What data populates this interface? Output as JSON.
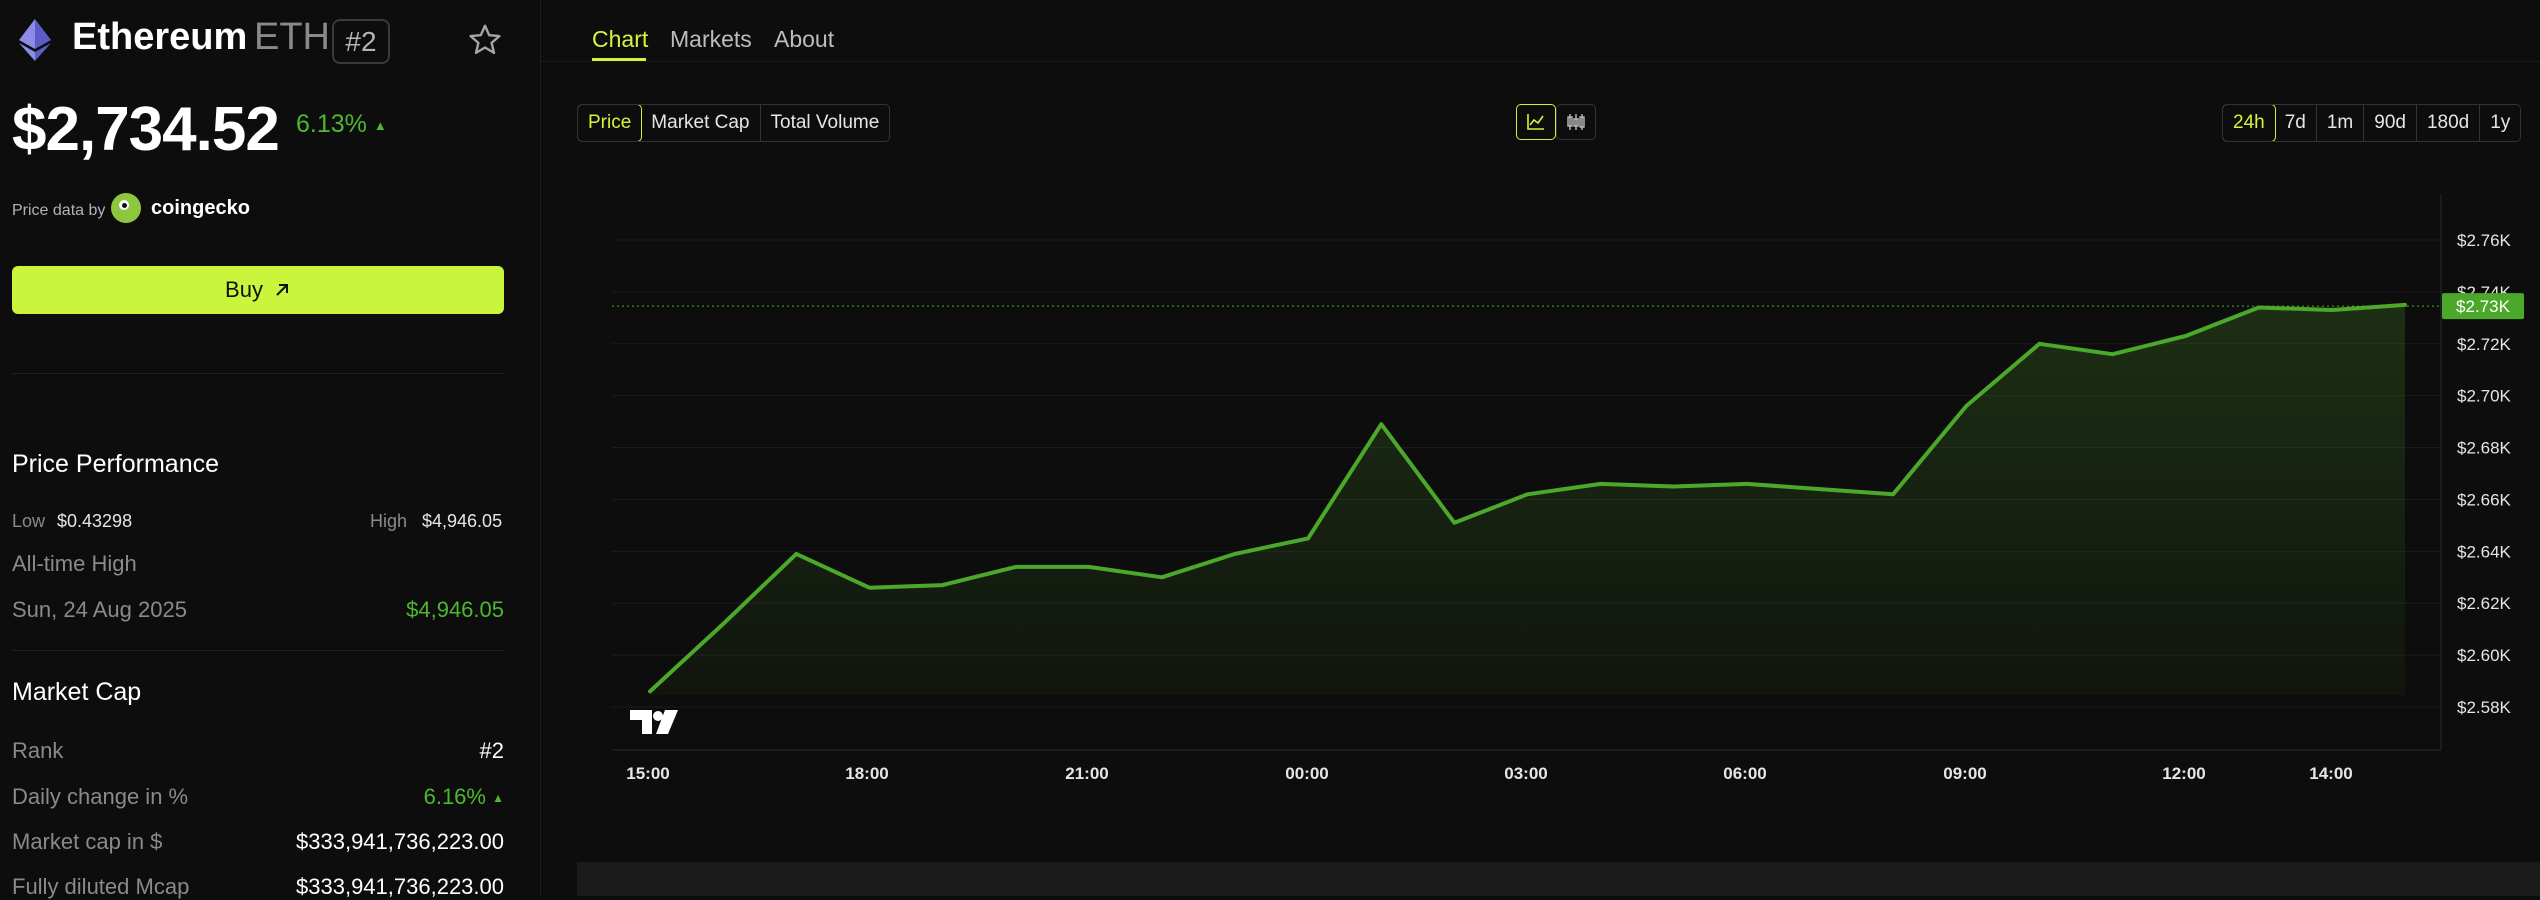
{
  "coin": {
    "name": "Ethereum",
    "symbol": "ETH",
    "rank_badge": "#2"
  },
  "price": "$2,734.52",
  "change_pct": "6.13%",
  "price_data": {
    "label": "Price data by",
    "provider": "coingecko"
  },
  "buy_label": "Buy",
  "performance": {
    "title": "Price Performance",
    "low_label": "Low",
    "low_value": "$0.43298",
    "high_label": "High",
    "high_value": "$4,946.05",
    "ath_label": "All-time High",
    "ath_date": "Sun, 24 Aug 2025",
    "ath_value": "$4,946.05"
  },
  "market_cap": {
    "title": "Market Cap",
    "rows": [
      {
        "label": "Rank",
        "value": "#2"
      },
      {
        "label": "Daily change in %",
        "value": "6.16%"
      },
      {
        "label": "Market cap in $",
        "value": "$333,941,736,223.00"
      },
      {
        "label": "Fully diluted Mcap",
        "value": "$333,941,736,223.00"
      }
    ]
  },
  "tabs": [
    "Chart",
    "Markets",
    "About"
  ],
  "metric_buttons": [
    "Price",
    "Market Cap",
    "Total Volume"
  ],
  "range_buttons": [
    "24h",
    "7d",
    "1m",
    "90d",
    "180d",
    "1y"
  ],
  "icons": {
    "chart_type_line": "line-chart-icon",
    "chart_type_candles": "candlestick-icon",
    "watermark": "tradingview-logo-icon"
  },
  "colors": {
    "accent": "#c9f53c",
    "positive": "#4cb82f",
    "line": "#4ca82a"
  },
  "chart_data": {
    "type": "area",
    "x_tick_labels": [
      "15:00",
      "18:00",
      "21:00",
      "00:00",
      "03:00",
      "06:00",
      "09:00",
      "12:00",
      "14:00"
    ],
    "y_tick_labels": [
      "$2.76K",
      "$2.74K",
      "$2.72K",
      "$2.70K",
      "$2.68K",
      "$2.66K",
      "$2.64K",
      "$2.62K",
      "$2.60K",
      "$2.58K"
    ],
    "ylim": [
      2.58,
      2.76
    ],
    "current_label": "$2.73K",
    "current_value": 2.7345,
    "series": [
      {
        "values": [
          2.586,
          2.612,
          2.639,
          2.626,
          2.627,
          2.634,
          2.634,
          2.63,
          2.639,
          2.645,
          2.689,
          2.651,
          2.662,
          2.666,
          2.665,
          2.666,
          2.664,
          2.662,
          2.696,
          2.72,
          2.716,
          2.723,
          2.734,
          2.733,
          2.735
        ]
      }
    ]
  }
}
